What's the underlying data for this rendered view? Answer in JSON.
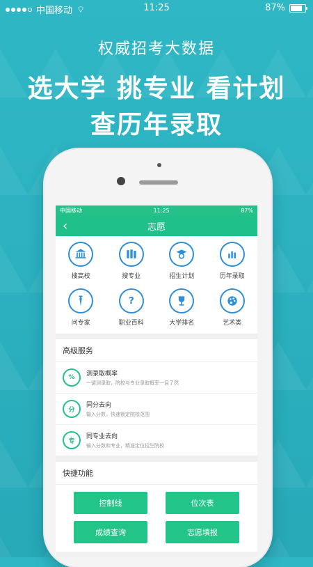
{
  "status_bar": {
    "carrier": "中国移动",
    "time": "11:25",
    "battery": "87%"
  },
  "hero": {
    "line1": "权威招考大数据",
    "line2": "选大学 挑专业 看计划",
    "line3": "查历年录取"
  },
  "app": {
    "status_bar": {
      "carrier": "中国移动",
      "time": "11:25",
      "battery": "87%"
    },
    "nav": {
      "title": "志愿"
    },
    "grid": [
      {
        "label": "搜高校",
        "icon": "university-icon"
      },
      {
        "label": "搜专业",
        "icon": "books-icon"
      },
      {
        "label": "招生计划",
        "icon": "graduate-icon"
      },
      {
        "label": "历年录取",
        "icon": "bar-chart-icon"
      },
      {
        "label": "问专家",
        "icon": "expert-icon"
      },
      {
        "label": "职业百科",
        "icon": "question-icon"
      },
      {
        "label": "大学排名",
        "icon": "trophy-icon"
      },
      {
        "label": "艺术类",
        "icon": "palette-icon"
      }
    ],
    "advanced": {
      "title": "高级服务",
      "items": [
        {
          "title": "测录取概率",
          "subtitle": "一键测录取，院校与专业录取概率一目了然",
          "icon": "percent-icon"
        },
        {
          "title": "同分去向",
          "subtitle": "输入分数，快速锁定院校范围",
          "icon": "score-icon"
        },
        {
          "title": "同专业去向",
          "subtitle": "输入分数和专业，精准定位招生院校",
          "icon": "major-icon"
        }
      ]
    },
    "quick": {
      "title": "快捷功能",
      "buttons": [
        "控制线",
        "位次表",
        "成绩查询",
        "志愿填报"
      ]
    }
  }
}
